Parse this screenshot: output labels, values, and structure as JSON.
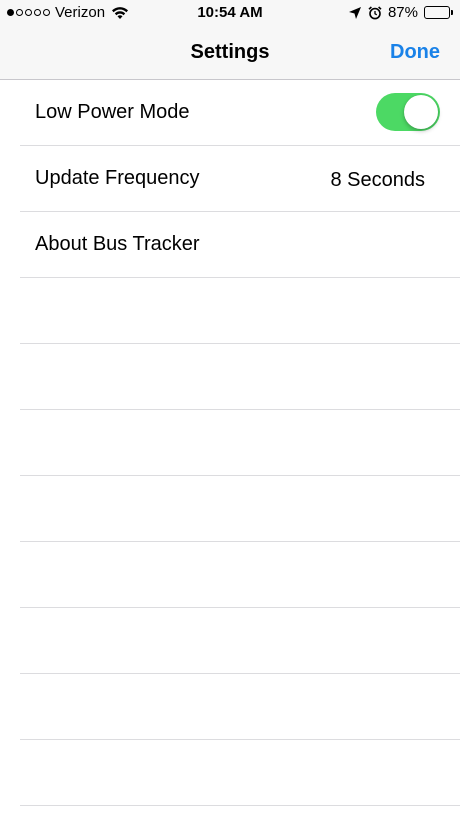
{
  "status_bar": {
    "carrier": "Verizon",
    "signal_bars_total": 5,
    "signal_bars_filled": 1,
    "time": "10:54 AM",
    "battery_percent": "87%",
    "battery_level": 0.87,
    "icons": [
      "wifi-icon",
      "location-arrow-icon",
      "alarm-clock-icon",
      "battery-icon"
    ]
  },
  "nav_bar": {
    "title": "Settings",
    "done_label": "Done",
    "accent_color": "#1a82e8"
  },
  "settings": {
    "rows": [
      {
        "label": "Low Power Mode",
        "control": "toggle",
        "on": true
      },
      {
        "label": "Update Frequency",
        "value": "8 Seconds"
      },
      {
        "label": "About Bus Tracker"
      }
    ],
    "toggle_on_color": "#4cd964"
  }
}
